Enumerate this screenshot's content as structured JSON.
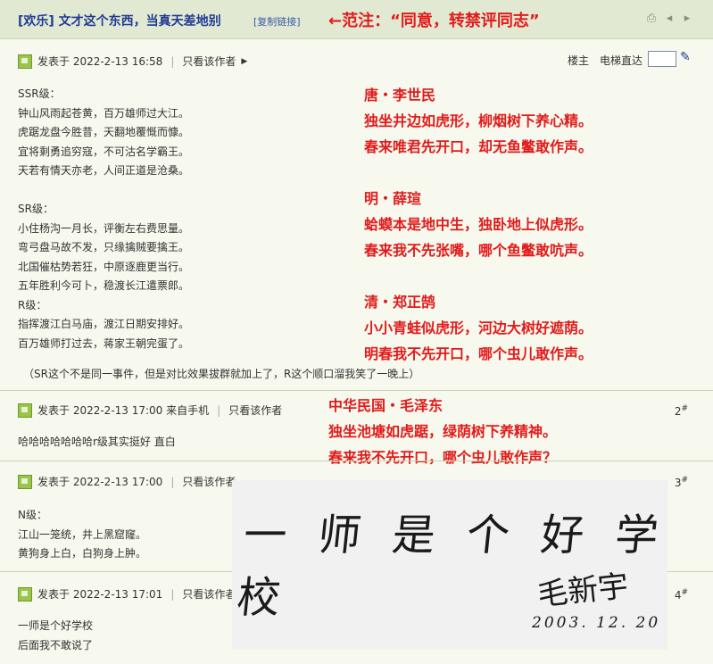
{
  "header": {
    "title": "[欢乐] 文才这个东西，当真天差地别",
    "copy_link": "[复制链接]",
    "annotation": "←范注：“同意，转禁评同志”"
  },
  "post1": {
    "meta": "发表于 2022-2-13 16:58",
    "only_author": "只看该作者",
    "louzhu": "楼主",
    "elevator": "电梯直达",
    "body_left": "SSR级：\n钟山风雨起苍黄，百万雄师过大江。\n虎踞龙盘今胜昔，天翻地覆慨而慷。\n宜将剩勇追穷寇，不可沽名学霸王。\n天若有情天亦老，人间正道是沧桑。\n\nSR级：\n小住杨沟一月长，评衡左右费思量。\n弯弓盘马故不发，只缘擒贼要擒王。\n北国催枯势若狂，中原逐鹿更当行。\n五年胜利今可卜，稳渡长江遣票郎。\nR级：\n指挥渡江白马庙，渡江日期安排好。\n百万雄师打过去，蒋家王朝完蛋了。",
    "red_right": "唐・李世民\n独坐井边如虎形，柳烟树下养心精。\n春来唯君先开口，却无鱼鳖敢作声。\n\n明・薛瑄\n蛤蟆本是地中生，独卧地上似虎形。\n春来我不先张嘴，哪个鱼鳖敢吭声。\n\n清・郑正鹄\n小小青蛙似虎形，河边大树好遮荫。\n明春我不先开口，哪个虫儿敢作声。",
    "footnote": "（SR这个不是同一事件，但是对比效果拔群就加上了，R这个顺口溜我笑了一晚上）"
  },
  "post2": {
    "meta": "发表于 2022-2-13 17:00 来自手机",
    "only_author": "只看该作者",
    "floor": "2",
    "body": "哈哈哈哈哈哈哈r级其实挺好 直白",
    "red": "中华民国・毛泽东\n独坐池塘如虎踞，绿荫树下养精神。\n春来我不先开口，哪个虫儿敢作声？"
  },
  "post3": {
    "meta": "发表于 2022-2-13 17:00",
    "only_author": "只看该作者",
    "floor": "3",
    "body": "N级：\n江山一笼统，井上黑窟窿。\n黄狗身上白，白狗身上肿。"
  },
  "post4": {
    "meta": "发表于 2022-2-13 17:01",
    "only_author": "只看该作者",
    "floor": "4",
    "body": "一师是个好学校\n后面我不敢说了"
  },
  "image": {
    "main": "一 师 是 个 好 学 校",
    "signature": "毛新宇",
    "date": "2003. 12. 20"
  }
}
